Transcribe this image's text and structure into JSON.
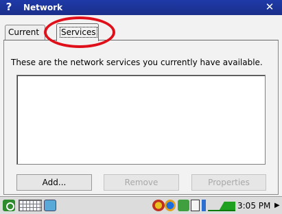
{
  "window": {
    "help_glyph": "?",
    "title": "Network",
    "close_glyph": "✕"
  },
  "tabs": [
    {
      "label": "Current"
    },
    {
      "label": "Services"
    }
  ],
  "main": {
    "description": "These are the network services you currently have available.",
    "services_list": []
  },
  "buttons": {
    "add": "Add...",
    "remove": "Remove",
    "properties": "Properties"
  },
  "taskbar": {
    "clock": "3:05 PM",
    "scroll_glyph": "▶"
  },
  "colors": {
    "titlebar": "#1e3aa8",
    "highlight": "#e0101a"
  }
}
